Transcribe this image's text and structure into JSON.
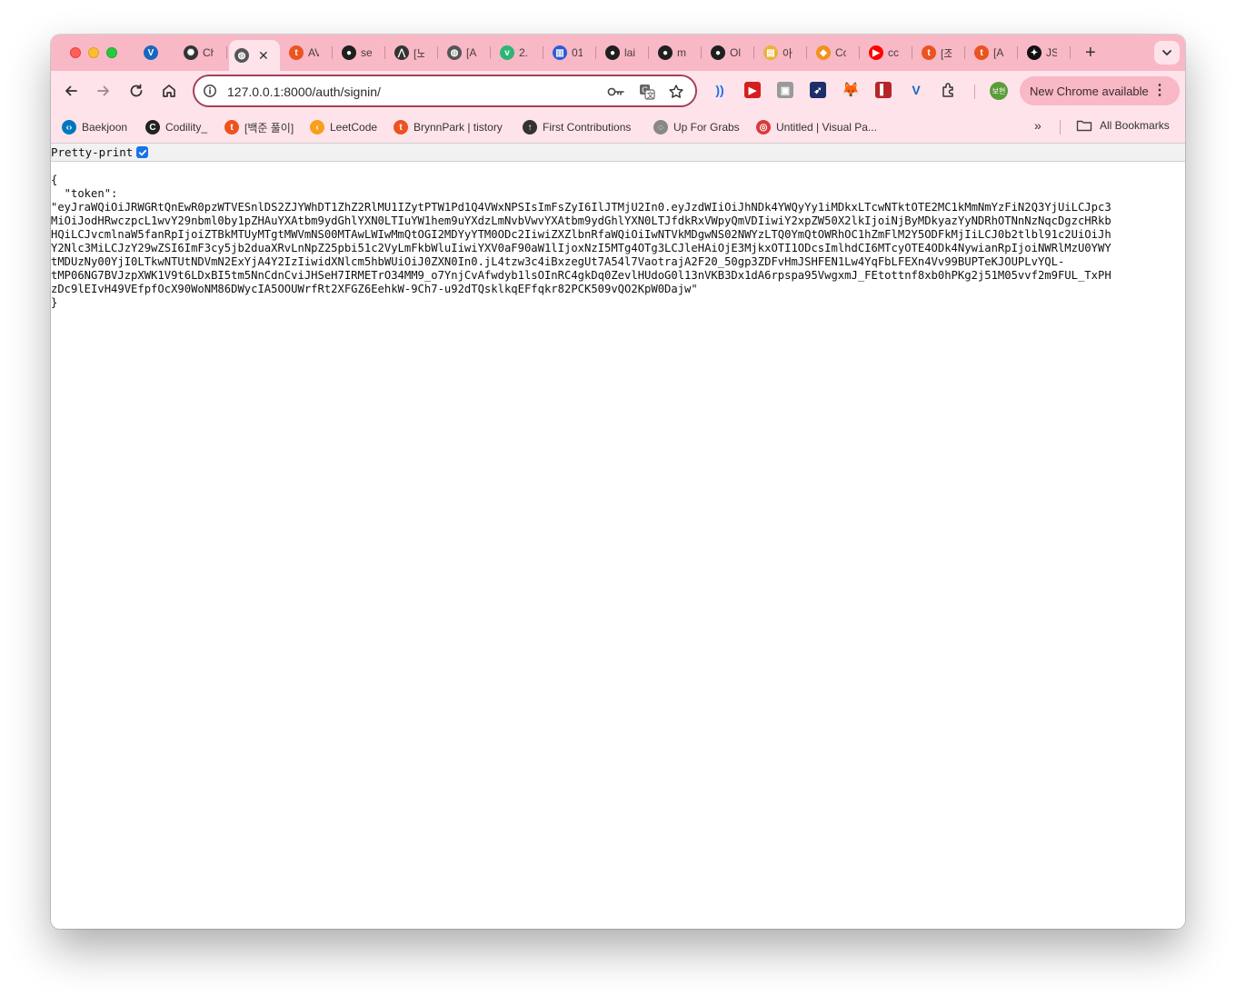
{
  "browser": {
    "tabs": [
      {
        "title": "",
        "icon": "vuetify-icon",
        "color": "#1867c0"
      },
      {
        "title": "Ch",
        "icon": "chatgpt-icon",
        "color": "#333333"
      },
      {
        "title": "",
        "icon": "globe-icon",
        "color": "#555555",
        "active": true
      },
      {
        "title": "AV",
        "icon": "tistory-icon",
        "color": "#eb531f"
      },
      {
        "title": "se",
        "icon": "github-icon",
        "color": "#1f1f1f"
      },
      {
        "title": "[노",
        "icon": "tree-icon",
        "color": "#333333"
      },
      {
        "title": "[A",
        "icon": "globe-icon",
        "color": "#555555"
      },
      {
        "title": "2.",
        "icon": "vue-icon",
        "color": "#2bb673"
      },
      {
        "title": "01",
        "icon": "book-icon",
        "color": "#2c5bd6"
      },
      {
        "title": "lai",
        "icon": "github-icon",
        "color": "#1f1f1f"
      },
      {
        "title": "m",
        "icon": "github-icon",
        "color": "#1f1f1f"
      },
      {
        "title": "Ol",
        "icon": "github-icon",
        "color": "#1f1f1f"
      },
      {
        "title": "아",
        "icon": "notes-icon",
        "color": "#e8b339"
      },
      {
        "title": "Cc",
        "icon": "box-icon",
        "color": "#f0921c"
      },
      {
        "title": "cc",
        "icon": "youtube-icon",
        "color": "#ff0000"
      },
      {
        "title": "[조",
        "icon": "tistory-icon",
        "color": "#eb531f"
      },
      {
        "title": "[A",
        "icon": "tistory-icon",
        "color": "#eb531f"
      },
      {
        "title": "JS",
        "icon": "code-icon",
        "color": "#111111"
      }
    ],
    "new_tab_label": "+",
    "url": "127.0.0.1:8000/auth/signin/",
    "update_button": "New Chrome available",
    "profile_label": "보현",
    "bookmarks": [
      {
        "label": "Baekjoon",
        "icon": "baekjoon-icon",
        "color": "#0076c0"
      },
      {
        "label": "Codility_",
        "icon": "codility-icon",
        "color": "#222222"
      },
      {
        "label": "[백준 풀이]",
        "icon": "tistory-icon",
        "color": "#eb531f"
      },
      {
        "label": "LeetCode",
        "icon": "leetcode-icon",
        "color": "#f89f1b"
      },
      {
        "label": "BrynnPark | tistory",
        "icon": "tistory-icon",
        "color": "#eb531f"
      },
      {
        "label": "First Contributions",
        "icon": "pin-icon",
        "color": "#333333"
      },
      {
        "label": "Up For Grabs",
        "icon": "upforgrabs-icon",
        "color": "#888888"
      },
      {
        "label": "Untitled | Visual Pa...",
        "icon": "visual-paradigm-icon",
        "color": "#d83b3b"
      }
    ],
    "bookmarks_more": "»",
    "all_bookmarks": "All Bookmarks"
  },
  "page": {
    "pretty_print_label": "Pretty-print",
    "pretty_print_checked": true,
    "json_lines": [
      "{",
      "  \"token\":",
      "\"eyJraWQiOiJRWGRtQnEwR0pzWTVESnlDS2ZJYWhDT1ZhZ2RlMU1IZytPTW1Pd1Q4VWxNPSIsImFsZyI6IlJTMjU2In0.eyJzdWIiOiJhNDk4YWQyYy1iMDkxLTcwNTktOTE2MC1kMmNmYzFiN2Q3YjUiLCJpc3",
      "MiOiJodHRwczpcL1wvY29nbml0by1pZHAuYXAtbm9ydGhlYXN0LTIuYW1hem9uYXdzLmNvbVwvYXAtbm9ydGhlYXN0LTJfdkRxVWpyQmVDIiwiY2xpZW50X2lkIjoiNjByMDkyazYyNDRhOTNnNzNqcDgzcHRkb",
      "HQiLCJvcmlnaW5fanRpIjoiZTBkMTUyMTgtMWVmNS00MTAwLWIwMmQtOGI2MDYyYTM0ODc2IiwiZXZlbnRfaWQiOiIwNTVkMDgwNS02NWYzLTQ0YmQtOWRhOC1hZmFlM2Y5ODFkMjIiLCJ0b2tlbl91c2UiOiJh",
      "Y2Nlc3MiLCJzY29wZSI6ImF3cy5jb2duaXRvLnNpZ25pbi51c2VyLmFkbWluIiwiYXV0aF90aW1lIjoxNzI5MTg4OTg3LCJleHAiOjE3MjkxOTI1ODcsImlhdCI6MTcyOTE4ODk4NywianRpIjoiNWRlMzU0YWY",
      "tMDUzNy00YjI0LTkwNTUtNDVmN2ExYjA4Y2IzIiwidXNlcm5hbWUiOiJ0ZXN0In0.jL4tzw3c4iBxzegUt7A54l7VaotrajA2F20_50gp3ZDFvHmJSHFEN1Lw4YqFbLFEXn4Vv99BUPTeKJOUPLvYQL-",
      "tMP06NG7BVJzpXWK1V9t6LDxBI5tm5NnCdnCviJHSeH7IRMETrO34MM9_o7YnjCvAfwdyb1lsOInRC4gkDq0ZevlHUdoG0l13nVKB3Dx1dA6rpspa95VwgxmJ_FEtottnf8xb0hPKg2j51M05vvf2m9FUL_TxPH",
      "zDc9lEIvH49VEfpfOcX90WoNM86DWycIA5OOUWrfRt2XFGZ6EehkW-9Ch7-u92dTQsklkqEFfqkr82PCK509vQO2KpW0Dajw\"",
      "}"
    ]
  },
  "colors": {
    "tab_strip": "#f8b8c6",
    "toolbar": "#ffe3ea",
    "accent": "#a3405b",
    "checkbox": "#1a73e8"
  }
}
